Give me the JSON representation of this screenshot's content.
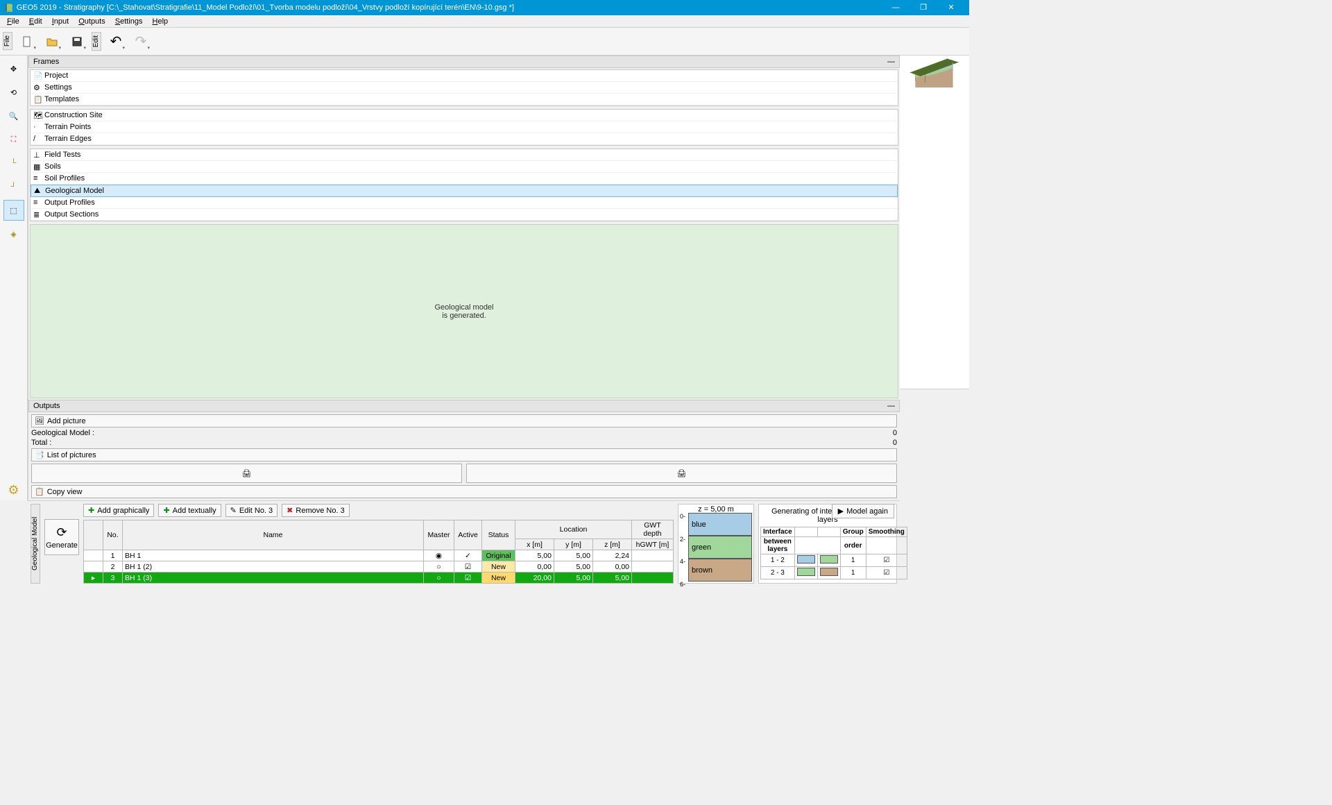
{
  "window": {
    "title": "GEO5 2019 - Stratigraphy [C:\\_Stahovat\\Stratigrafie\\11_Model Podloží\\01_Tvorba modelu podloží\\04_Vrstvy podloží kopírující terén\\EN\\9-10.gsg *]"
  },
  "menus": [
    "File",
    "Edit",
    "Input",
    "Outputs",
    "Settings",
    "Help"
  ],
  "buttons": {
    "add_graph": "Add graphically",
    "add_text": "Add textually",
    "edit": "Edit No. 3",
    "remove": "Remove No. 3",
    "model_again": "Model again",
    "generate": "Generate",
    "add_picture": "Add picture",
    "list_pictures": "List of pictures",
    "copy_view": "Copy view"
  },
  "frames": {
    "hdr": "Frames",
    "items": [
      {
        "label": "Project"
      },
      {
        "label": "Settings"
      },
      {
        "label": "Templates"
      },
      {
        "label": "Construction Site"
      },
      {
        "label": "Terrain Points"
      },
      {
        "label": "Terrain Edges"
      },
      {
        "label": "Field Tests"
      },
      {
        "label": "Soils"
      },
      {
        "label": "Soil Profiles"
      },
      {
        "label": "Geological Model",
        "sel": true
      },
      {
        "label": "Output Profiles"
      },
      {
        "label": "Output Sections"
      }
    ],
    "status": "Geological model\nis generated."
  },
  "outputs": {
    "hdr": "Outputs",
    "geo_label": "Geological Model :",
    "geo_val": "0",
    "total_label": "Total :",
    "total_val": "0"
  },
  "vtabs": {
    "file": "File",
    "edit": "Edit",
    "geom": "Geological Model"
  },
  "viewport": {
    "labels": {
      "bh1": "BH 1",
      "bh12": "BH 1 (2)",
      "bh13": "BH 1 (3)"
    }
  },
  "table": {
    "headers": {
      "no": "No.",
      "name": "Name",
      "master": "Master",
      "active": "Active",
      "status": "Status",
      "location": "Location",
      "x": "x [m]",
      "y": "y [m]",
      "z": "z [m]",
      "gwt": "GWT depth",
      "hgwt": "hGWT [m]"
    },
    "rows": [
      {
        "no": "1",
        "name": "BH 1",
        "master": "dot",
        "active": "check",
        "status": "Original",
        "x": "5,00",
        "y": "5,00",
        "z": "2,24",
        "gwt": ""
      },
      {
        "no": "2",
        "name": "BH 1 (2)",
        "master": "o",
        "active": "box",
        "status": "New",
        "x": "0,00",
        "y": "5,00",
        "z": "0,00",
        "gwt": ""
      },
      {
        "no": "3",
        "name": "BH 1 (3)",
        "master": "o",
        "active": "box",
        "status": "New",
        "x": "20,00",
        "y": "5,00",
        "z": "5,00",
        "gwt": "",
        "sel": true
      }
    ]
  },
  "legend": {
    "z": "z = 5,00 m",
    "ticks": [
      "0",
      "2",
      "4",
      "6"
    ],
    "layers": [
      {
        "name": "blue",
        "col": "#a7cde6"
      },
      {
        "name": "green",
        "col": "#9fd89a"
      },
      {
        "name": "brown",
        "col": "#c9a887"
      }
    ]
  },
  "interfaces": {
    "title": "Generating of interfaces between layers",
    "cols": {
      "iface": "Interface",
      "between": "between layers",
      "group": "Group",
      "order": "order",
      "smoothing": "Smoothing"
    },
    "rows": [
      {
        "iface": "1 - 2",
        "c1": "#a7cde6",
        "c2": "#9fd89a",
        "order": "1",
        "sm": true
      },
      {
        "iface": "2 - 3",
        "c1": "#9fd89a",
        "c2": "#c9a887",
        "order": "1",
        "sm": true
      }
    ]
  }
}
